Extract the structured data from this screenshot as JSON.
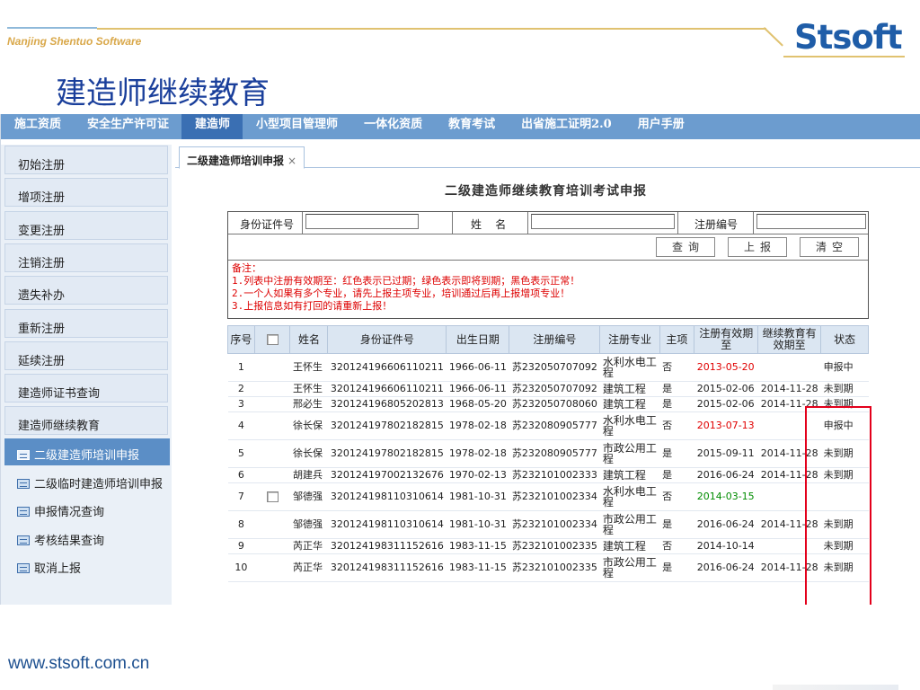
{
  "header": {
    "company": "Nanjing Shentuo Software",
    "logo": "Stsoft",
    "slide_title": "建造师继续教育"
  },
  "nav": [
    "施工资质",
    "安全生产许可证",
    "建造师",
    "小型项目管理师",
    "一体化资质",
    "教育考试",
    "出省施工证明2.0",
    "用户手册"
  ],
  "nav_active_index": 2,
  "sidebar": {
    "items": [
      "初始注册",
      "增项注册",
      "变更注册",
      "注销注册",
      "遗失补办",
      "重新注册",
      "延续注册",
      "建造师证书查询",
      "建造师继续教育"
    ],
    "sub_items": [
      "二级建造师培训申报",
      "二级临时建造师培训申报",
      "申报情况查询",
      "考核结果查询",
      "取消上报"
    ],
    "active_sub_index": 0
  },
  "tab": {
    "label": "二级建造师培训申报",
    "close": "×"
  },
  "form": {
    "title": "二级建造师继续教育培训考试申报",
    "id_label": "身份证件号",
    "name_label": "姓    名",
    "reg_label": "注册编号",
    "id_value": "",
    "name_value": "",
    "reg_value": "",
    "query_button": "查询",
    "submit_button": "上报",
    "clear_button": "清空",
    "notes": [
      "备注：",
      "1.列表中注册有效期至：红色表示已过期；绿色表示即将到期；黑色表示正常！",
      "2.一个人如果有多个专业，请先上报主项专业，培训通过后再上报增项专业！",
      "3.上报信息如有打回的请重新上报！"
    ]
  },
  "table": {
    "headers": [
      "序号",
      "",
      "姓名",
      "身份证件号",
      "出生日期",
      "注册编号",
      "注册专业",
      "主项",
      "注册有效期至",
      "继续教育有效期至",
      "状态"
    ],
    "rows": [
      {
        "no": "1",
        "check": false,
        "name": "王怀生",
        "id": "320124196606110211",
        "birth": "1966-06-11",
        "reg": "苏232050707092",
        "major": "水利水电工程",
        "main": "否",
        "valid": "2013-05-20",
        "valid_color": "red",
        "edu": "",
        "status": "申报中"
      },
      {
        "no": "2",
        "check": false,
        "name": "王怀生",
        "id": "320124196606110211",
        "birth": "1966-06-11",
        "reg": "苏232050707092",
        "major": "建筑工程",
        "main": "是",
        "valid": "2015-02-06",
        "valid_color": "",
        "edu": "2014-11-28",
        "status": "未到期"
      },
      {
        "no": "3",
        "check": false,
        "name": "邢必生",
        "id": "320124196805202813",
        "birth": "1968-05-20",
        "reg": "苏232050708060",
        "major": "建筑工程",
        "main": "是",
        "valid": "2015-02-06",
        "valid_color": "",
        "edu": "2014-11-28",
        "status": "未到期"
      },
      {
        "no": "4",
        "check": false,
        "name": "徐长保",
        "id": "320124197802182815",
        "birth": "1978-02-18",
        "reg": "苏232080905777",
        "major": "水利水电工程",
        "main": "否",
        "valid": "2013-07-13",
        "valid_color": "red",
        "edu": "",
        "status": "申报中"
      },
      {
        "no": "5",
        "check": false,
        "name": "徐长保",
        "id": "320124197802182815",
        "birth": "1978-02-18",
        "reg": "苏232080905777",
        "major": "市政公用工程",
        "main": "是",
        "valid": "2015-09-11",
        "valid_color": "",
        "edu": "2014-11-28",
        "status": "未到期"
      },
      {
        "no": "6",
        "check": false,
        "name": "胡建兵",
        "id": "320124197002132676",
        "birth": "1970-02-13",
        "reg": "苏232101002333",
        "major": "建筑工程",
        "main": "是",
        "valid": "2016-06-24",
        "valid_color": "",
        "edu": "2014-11-28",
        "status": "未到期"
      },
      {
        "no": "7",
        "check": true,
        "name": "邹德强",
        "id": "320124198110310614",
        "birth": "1981-10-31",
        "reg": "苏232101002334",
        "major": "水利水电工程",
        "main": "否",
        "valid": "2014-03-15",
        "valid_color": "green",
        "edu": "",
        "status": ""
      },
      {
        "no": "8",
        "check": false,
        "name": "邹德强",
        "id": "320124198110310614",
        "birth": "1981-10-31",
        "reg": "苏232101002334",
        "major": "市政公用工程",
        "main": "是",
        "valid": "2016-06-24",
        "valid_color": "",
        "edu": "2014-11-28",
        "status": "未到期"
      },
      {
        "no": "9",
        "check": false,
        "name": "芮正华",
        "id": "320124198311152616",
        "birth": "1983-11-15",
        "reg": "苏232101002335",
        "major": "建筑工程",
        "main": "否",
        "valid": "2014-10-14",
        "valid_color": "",
        "edu": "",
        "status": "未到期"
      },
      {
        "no": "10",
        "check": false,
        "name": "芮正华",
        "id": "320124198311152616",
        "birth": "1983-11-15",
        "reg": "苏232101002335",
        "major": "市政公用工程",
        "main": "是",
        "valid": "2016-06-24",
        "valid_color": "",
        "edu": "2014-11-28",
        "status": "未到期"
      }
    ]
  },
  "footer": {
    "url": "www.stsoft.com.cn"
  },
  "colors": {
    "brand": "#1f5da8",
    "title": "#1a3f9b",
    "nav": "#6c9ccf",
    "expired": "#e00000",
    "expiring": "#008c00",
    "highlight": "#e3001b"
  }
}
